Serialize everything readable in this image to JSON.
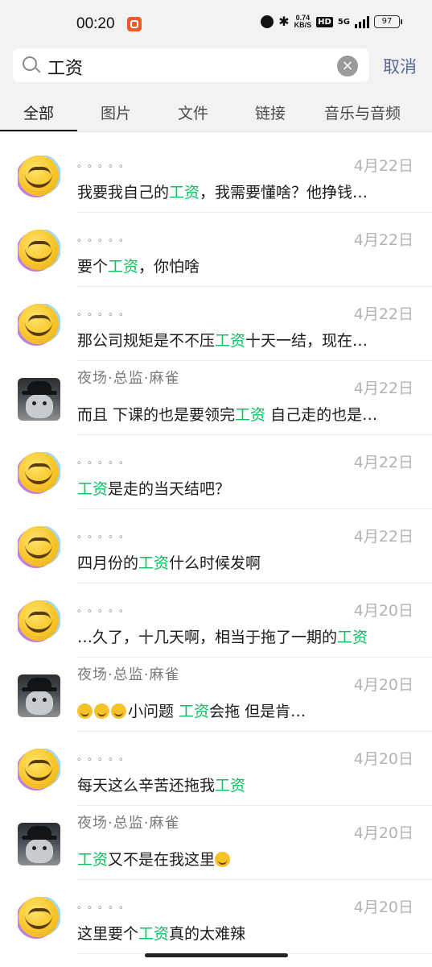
{
  "status_bar": {
    "time": "00:20",
    "speed_value": "0.74",
    "speed_unit": "KB/S",
    "hd": "HD",
    "network": "5G",
    "battery": "97"
  },
  "search": {
    "query": "工资",
    "cancel_label": "取消"
  },
  "tabs": [
    {
      "label": "全部",
      "active": true
    },
    {
      "label": "图片"
    },
    {
      "label": "文件"
    },
    {
      "label": "链接"
    },
    {
      "label": "音乐与音频"
    }
  ],
  "highlight_color": "#07c160",
  "results": [
    {
      "name": "。。。。。",
      "avatar": "smiley-emoji",
      "date": "4月22日",
      "segments": [
        [
          "我要我自己的",
          0
        ],
        [
          "工资",
          1
        ],
        [
          "，我需要懂啥？他挣钱…",
          0
        ]
      ]
    },
    {
      "name": "。。。。。",
      "avatar": "smiley-emoji",
      "date": "4月22日",
      "segments": [
        [
          "要个",
          0
        ],
        [
          "工资",
          1
        ],
        [
          "，你怕啥",
          0
        ]
      ]
    },
    {
      "name": "。。。。。",
      "avatar": "smiley-emoji",
      "date": "4月22日",
      "segments": [
        [
          "那公司规矩是不不压",
          0
        ],
        [
          "工资",
          1
        ],
        [
          "十天一结，现在…",
          0
        ]
      ]
    },
    {
      "name": "夜场·总监·麻雀",
      "avatar": "cat-photo",
      "date": "4月22日",
      "segments": [
        [
          "而且 下课的也是要领完",
          0
        ],
        [
          "工资",
          1
        ],
        [
          " 自己走的也是…",
          0
        ]
      ]
    },
    {
      "name": "。。。。。",
      "avatar": "smiley-emoji",
      "date": "4月22日",
      "segments": [
        [
          "工资",
          1
        ],
        [
          "是走的当天结吧？",
          0
        ]
      ]
    },
    {
      "name": "。。。。。",
      "avatar": "smiley-emoji",
      "date": "4月22日",
      "segments": [
        [
          "四月份的",
          0
        ],
        [
          "工资",
          1
        ],
        [
          "什么时候发啊",
          0
        ]
      ]
    },
    {
      "name": "。。。。。",
      "avatar": "smiley-emoji",
      "date": "4月20日",
      "segments": [
        [
          "…久了，十几天啊，相当于拖了一期的",
          0
        ],
        [
          "工资",
          1
        ]
      ]
    },
    {
      "name": "夜场·总监·麻雀",
      "avatar": "cat-photo",
      "date": "4月20日",
      "emoji_prefix": 3,
      "segments": [
        [
          "小问题 ",
          0
        ],
        [
          "工资",
          1
        ],
        [
          "会拖 但是肯…",
          0
        ]
      ]
    },
    {
      "name": "。。。。。",
      "avatar": "smiley-emoji",
      "date": "4月20日",
      "segments": [
        [
          "每天这么辛苦还拖我",
          0
        ],
        [
          "工资",
          1
        ]
      ]
    },
    {
      "name": "夜场·总监·麻雀",
      "avatar": "cat-photo",
      "date": "4月20日",
      "emoji_suffix": 1,
      "segments": [
        [
          "工资",
          1
        ],
        [
          "又不是在我这里",
          0
        ]
      ]
    },
    {
      "name": "。。。。。",
      "avatar": "smiley-emoji",
      "date": "4月20日",
      "segments": [
        [
          "这里要个",
          0
        ],
        [
          "工资",
          1
        ],
        [
          "真的太难辣",
          0
        ]
      ]
    }
  ]
}
